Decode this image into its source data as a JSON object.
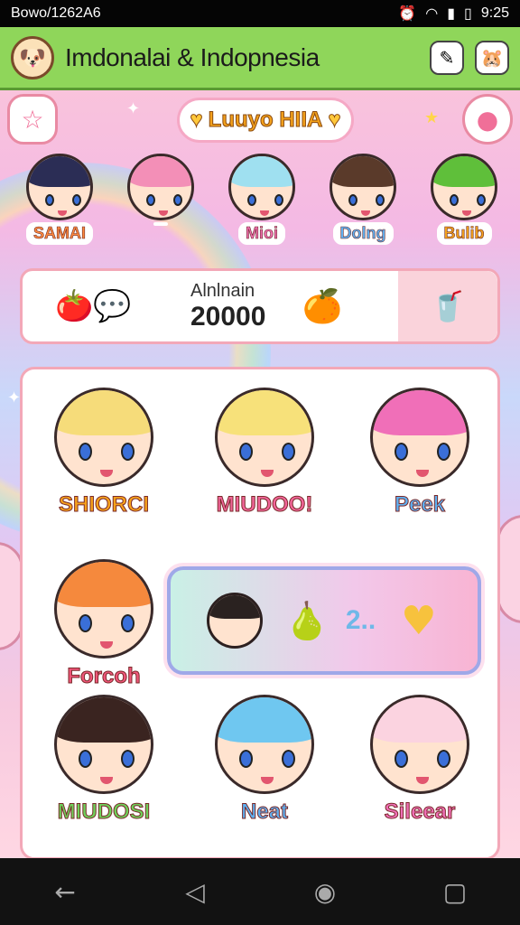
{
  "status_bar": {
    "left_text": "Bowo/1262A6",
    "time": "9:25"
  },
  "app_bar": {
    "title": "Imdonalai & Indopnesia",
    "logo_icon": "puppy-avatar-icon",
    "actions": [
      "edit-icon",
      "hamster-icon"
    ]
  },
  "banner": {
    "title": "Luuyo HIIA"
  },
  "characters": [
    {
      "label": "SAMAI",
      "hair": "#2b2d55",
      "color": "#ff8a3d"
    },
    {
      "label": "",
      "hair": "#f38fb7",
      "color": "#ff6b9a"
    },
    {
      "label": "Mioi",
      "hair": "#9fe0f0",
      "color": "#f06fb0"
    },
    {
      "label": "Dolng",
      "hair": "#5a3a2a",
      "color": "#5fb0f0"
    },
    {
      "label": "Bulib",
      "hair": "#5fbf3a",
      "color": "#f2a11b"
    }
  ],
  "summary_card": {
    "name": "Alnlnain",
    "amount": "20000"
  },
  "grid": {
    "items": [
      {
        "label": "SHIORCI",
        "hair": "#f6dc7a",
        "color": "#f6a21b"
      },
      {
        "label": "MIUDOO!",
        "hair": "#f7e17a",
        "color": "#f2659a"
      },
      {
        "label": "Peek",
        "hair": "#f06fb8",
        "color": "#5fb0f0"
      },
      {
        "label": "Forcoh",
        "hair": "#f5893d",
        "color": "#f0567a"
      },
      {
        "label": "MIUDOSI",
        "hair": "#3a2420",
        "color": "#6ed05a"
      },
      {
        "label": "Neat",
        "hair": "#6fc7f0",
        "color": "#5fb0f0"
      },
      {
        "label": "Sileear",
        "hair": "#fbd3e0",
        "color": "#f06fb8"
      }
    ],
    "promo": {
      "value": "2.."
    }
  },
  "nav": {
    "back": "back-arrow-icon",
    "home": "home-circle-icon",
    "recent": "recent-square-icon"
  }
}
